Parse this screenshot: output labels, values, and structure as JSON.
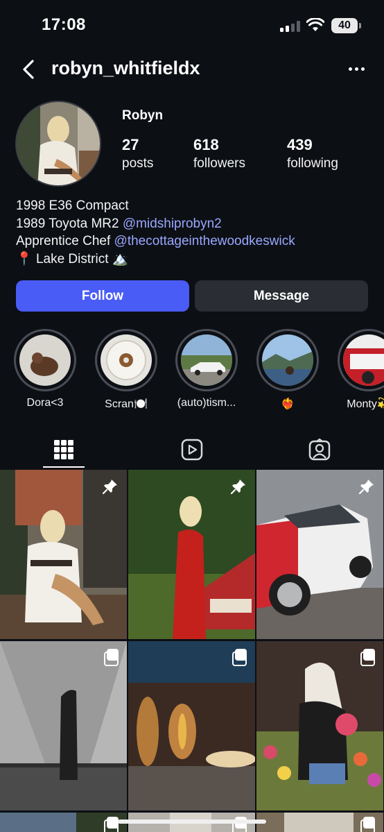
{
  "status_bar": {
    "time": "17:08",
    "battery": "40"
  },
  "header": {
    "username": "robyn_whitfieldx"
  },
  "profile": {
    "display_name": "Robyn",
    "stats": [
      {
        "value": "27",
        "label": "posts"
      },
      {
        "value": "618",
        "label": "followers"
      },
      {
        "value": "439",
        "label": "following"
      }
    ],
    "bio": {
      "line1": "1998 E36 Compact",
      "line2_text": "1989 Toyota MR2 ",
      "line2_mention": "@midshiprobyn2",
      "line3_text": "Apprentice Chef ",
      "line3_mention": "@thecottageinthewoodkeswick",
      "line4_pin": "📍",
      "line4_text": " Lake District ",
      "line4_emoji": "🏔️"
    }
  },
  "actions": {
    "follow_label": "Follow",
    "message_label": "Message"
  },
  "highlights": [
    {
      "label": "Dora<3"
    },
    {
      "label": "Scran🍽️"
    },
    {
      "label": "(auto)tism..."
    },
    {
      "label": "❤️‍🔥"
    },
    {
      "label": "Monty💫"
    }
  ],
  "tabs": [
    "posts-grid",
    "reels",
    "tagged"
  ],
  "colors": {
    "accent": "#4a5cf6",
    "mention": "#9aa7ff",
    "background": "#0c0f14"
  }
}
